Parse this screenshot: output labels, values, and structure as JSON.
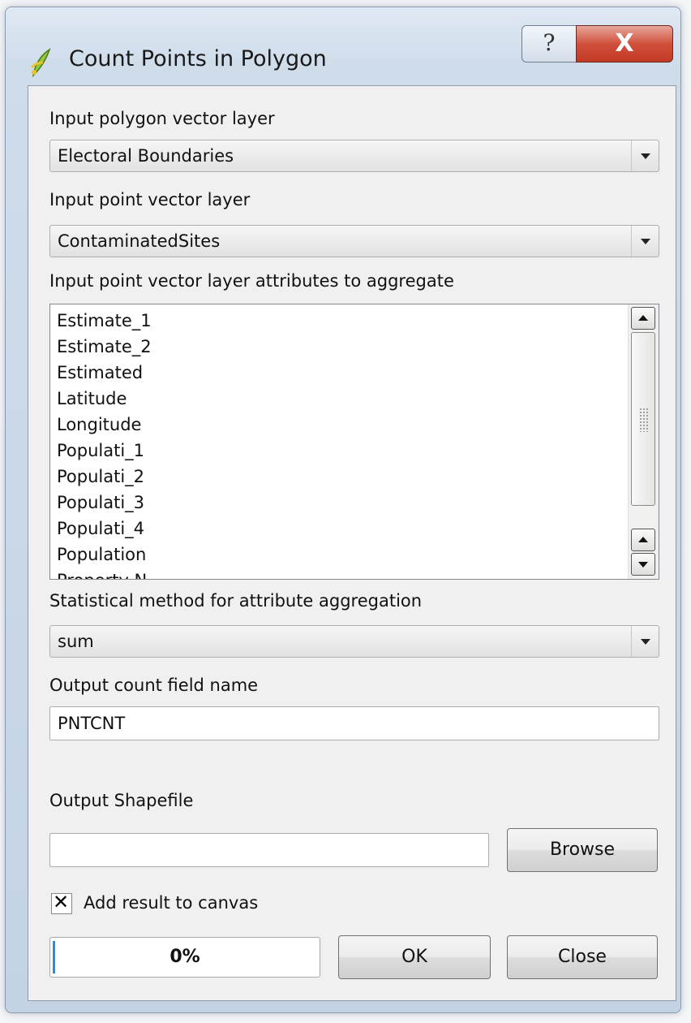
{
  "window": {
    "title": "Count Points in Polygon",
    "help_glyph": "?",
    "close_glyph": "X"
  },
  "form": {
    "polygon_layer_label": "Input polygon vector layer",
    "polygon_layer_value": "Electoral Boundaries",
    "point_layer_label": "Input point vector layer",
    "point_layer_value": "ContaminatedSites",
    "attributes_label": "Input point vector layer attributes to aggregate",
    "attributes": [
      "Estimate_1",
      "Estimate_2",
      "Estimated",
      "Latitude",
      "Longitude",
      "Populati_1",
      "Populati_2",
      "Populati_3",
      "Populati_4",
      "Population",
      "Property N"
    ],
    "method_label": "Statistical method for attribute aggregation",
    "method_value": "sum",
    "count_field_label": "Output count field name",
    "count_field_value": "PNTCNT",
    "output_label": "Output Shapefile",
    "output_value": "",
    "browse_label": "Browse",
    "add_to_canvas_label": "Add result to canvas",
    "add_to_canvas_checked": true,
    "progress_text": "0%",
    "progress_value": 0.01,
    "ok_label": "OK",
    "close_label": "Close"
  },
  "icons": {
    "app": "qgis-icon",
    "help": "help-icon",
    "close": "close-icon",
    "dropdown": "chevron-down-icon"
  },
  "colors": {
    "close_button": "#c8412b",
    "progress": "#1f8ee8"
  }
}
